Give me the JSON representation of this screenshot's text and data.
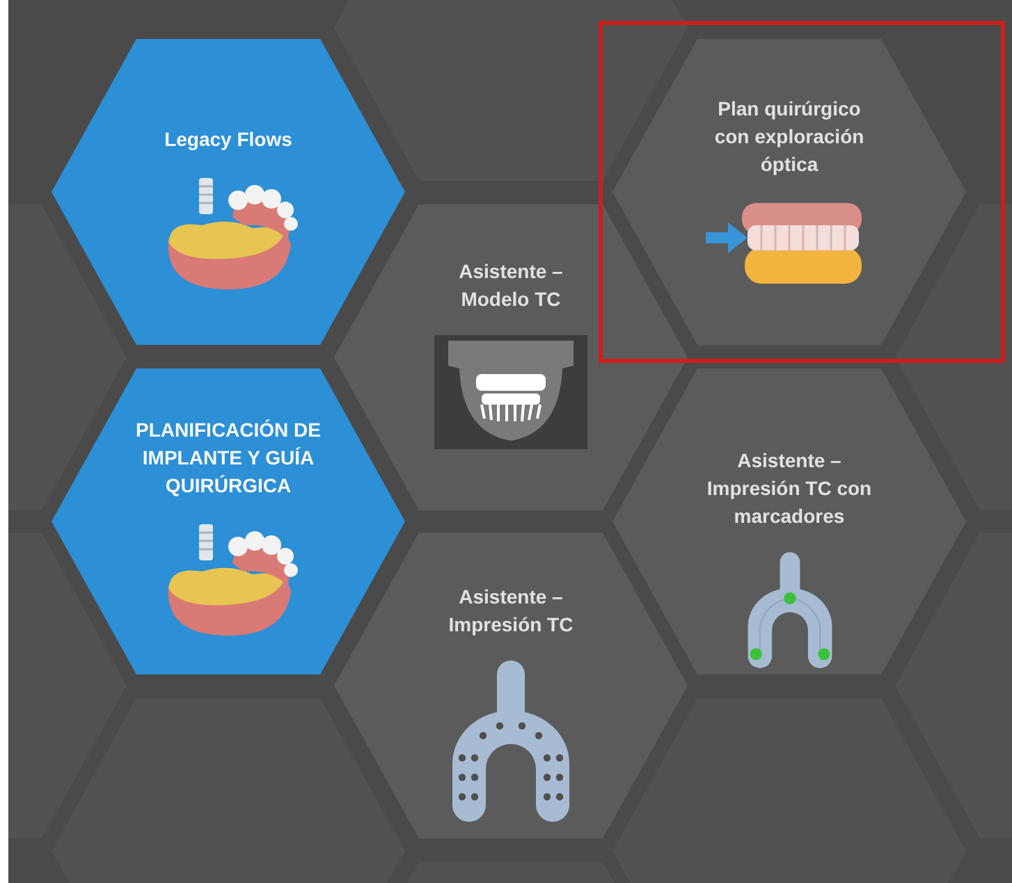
{
  "tiles": [
    {
      "title": "Legacy Flows",
      "color": "#2d8fd5",
      "kind": "implant-jaw",
      "selected": false
    },
    {
      "title": "Asistente – Modelo TC",
      "color": "#5b5b5b",
      "kind": "xray",
      "selected": false
    },
    {
      "title": "Plan quirúrgico con exploración óptica",
      "color": "#5b5b5b",
      "kind": "bite-arrow",
      "selected": true
    },
    {
      "title": "PLANIFICACIÓN DE IMPLANTE Y GUÍA QUIRÚRGICA",
      "color": "#2d8fd5",
      "kind": "implant-jaw",
      "selected": false
    },
    {
      "title": "Asistente – Impresión TC con marcadores",
      "color": "#5b5b5b",
      "kind": "marker-tray",
      "selected": false
    },
    {
      "title": "Asistente – Impresión TC",
      "color": "#5b5b5b",
      "kind": "perforated-tray",
      "selected": false
    }
  ]
}
